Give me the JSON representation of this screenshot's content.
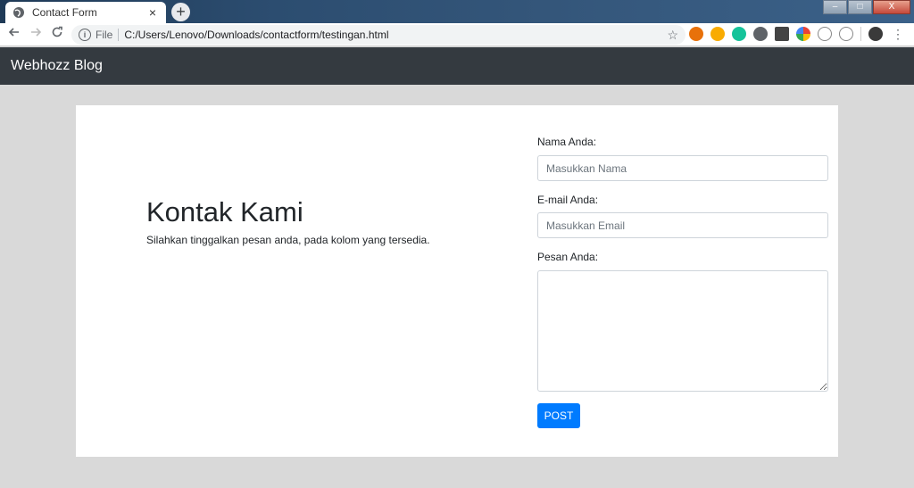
{
  "browser": {
    "tab_title": "Contact Form",
    "tab_close": "×",
    "new_tab": "+",
    "scheme_label": "File",
    "address": "C:/Users/Lenovo/Downloads/contactform/testingan.html",
    "window_controls": {
      "minimize": "–",
      "maximize": "□",
      "close": "X"
    },
    "icons": {
      "back": "arrow-left-icon",
      "forward": "arrow-right-icon",
      "reload": "reload-icon",
      "info": "info-icon",
      "star": "star-icon",
      "menu": "three-dots-menu-icon"
    }
  },
  "navbar": {
    "brand": "Webhozz Blog"
  },
  "hero": {
    "title": "Kontak Kami",
    "subtitle": "Silahkan tinggalkan pesan anda, pada kolom yang tersedia."
  },
  "form": {
    "name_label": "Nama Anda:",
    "name_placeholder": "Masukkan Nama",
    "name_value": "",
    "email_label": "E-mail Anda:",
    "email_placeholder": "Masukkan Email",
    "email_value": "",
    "message_label": "Pesan Anda:",
    "message_value": "",
    "submit_label": "POST"
  },
  "colors": {
    "navbar_bg": "#343a40",
    "page_bg": "#d9d9d9",
    "button_primary": "#007bff"
  }
}
